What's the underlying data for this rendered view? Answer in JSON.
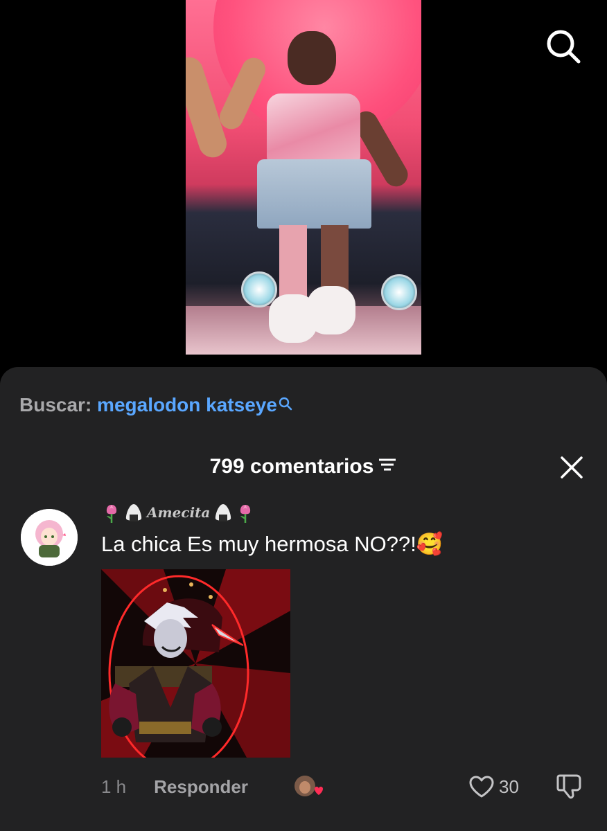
{
  "colors": {
    "background": "#000000",
    "sheet": "#222223",
    "search_query": "#5aa7ff",
    "muted_text": "#a9a9ab"
  },
  "search_bar": {
    "label": "Buscar:",
    "query": "megalodon katseye"
  },
  "comments": {
    "header": "799 comentarios",
    "items": [
      {
        "username": "Amecita",
        "text": "La chica Es muy hermosa NO??!",
        "emoji": "🥰",
        "time": "1 h",
        "reply_label": "Responder",
        "likes": "30"
      }
    ]
  },
  "icons": [
    "search-icon",
    "sort-icon",
    "close-icon",
    "heart-icon",
    "dislike-icon",
    "tulip-icon",
    "onigiri-icon"
  ]
}
